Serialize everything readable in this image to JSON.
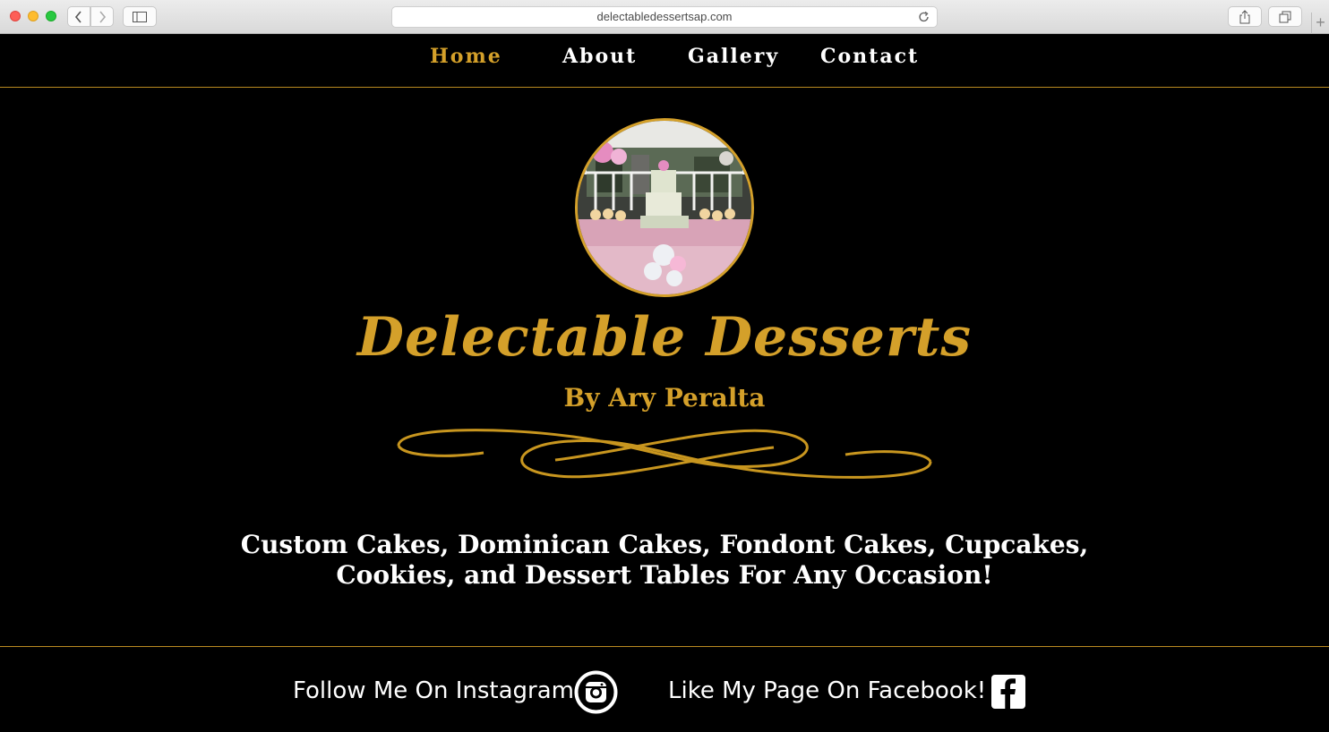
{
  "browser": {
    "url": "delectabledessertsap.com"
  },
  "nav": {
    "items": [
      {
        "label": "Home",
        "active": true
      },
      {
        "label": "About",
        "active": false
      },
      {
        "label": "Gallery",
        "active": false
      },
      {
        "label": "Contact",
        "active": false
      }
    ]
  },
  "hero": {
    "title": "Delectable Desserts",
    "subtitle": "By Ary Peralta",
    "tagline": "Custom Cakes, Dominican Cakes, Fondont Cakes, Cupcakes, Cookies, and Dessert Tables For Any Occasion!"
  },
  "footer": {
    "instagram_text": "Follow Me On Instagram",
    "facebook_text": "Like My Page On Facebook!"
  },
  "colors": {
    "accent": "#d4a02a",
    "background": "#000000",
    "text": "#ffffff"
  }
}
